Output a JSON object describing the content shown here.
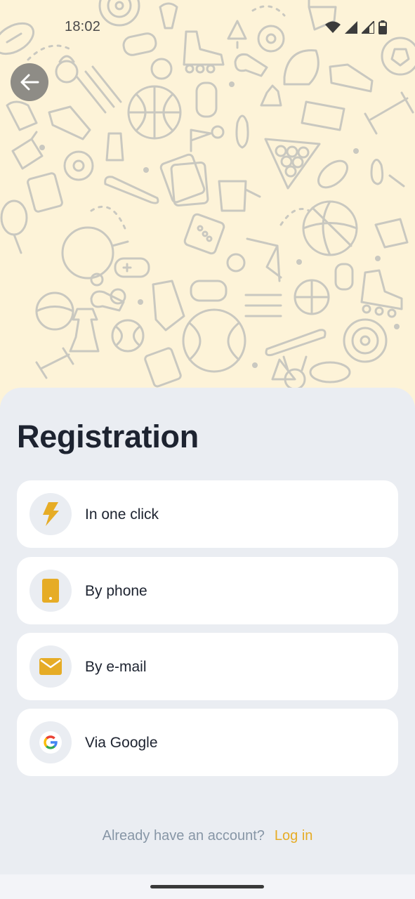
{
  "status_bar": {
    "time": "18:02",
    "icons": [
      "wifi-icon",
      "signal-icon",
      "signal-icon",
      "battery-icon"
    ]
  },
  "header": {
    "back_icon": "arrow-left-icon",
    "background_pattern": "sports-doodle-pattern"
  },
  "colors": {
    "pattern_background": "#fdf3d8",
    "pattern_stroke": "#c9c8c0",
    "sheet_background": "#eaedf2",
    "accent": "#e6ac26",
    "text_primary": "#1d2330",
    "text_secondary": "#8796a6"
  },
  "registration": {
    "title": "Registration",
    "options": [
      {
        "label": "In one click",
        "icon": "lightning-icon"
      },
      {
        "label": "By phone",
        "icon": "phone-icon"
      },
      {
        "label": "By e-mail",
        "icon": "envelope-icon"
      },
      {
        "label": "Via Google",
        "icon": "google-icon"
      }
    ]
  },
  "footer": {
    "prompt": "Already have an account?",
    "login_link": "Log in"
  }
}
